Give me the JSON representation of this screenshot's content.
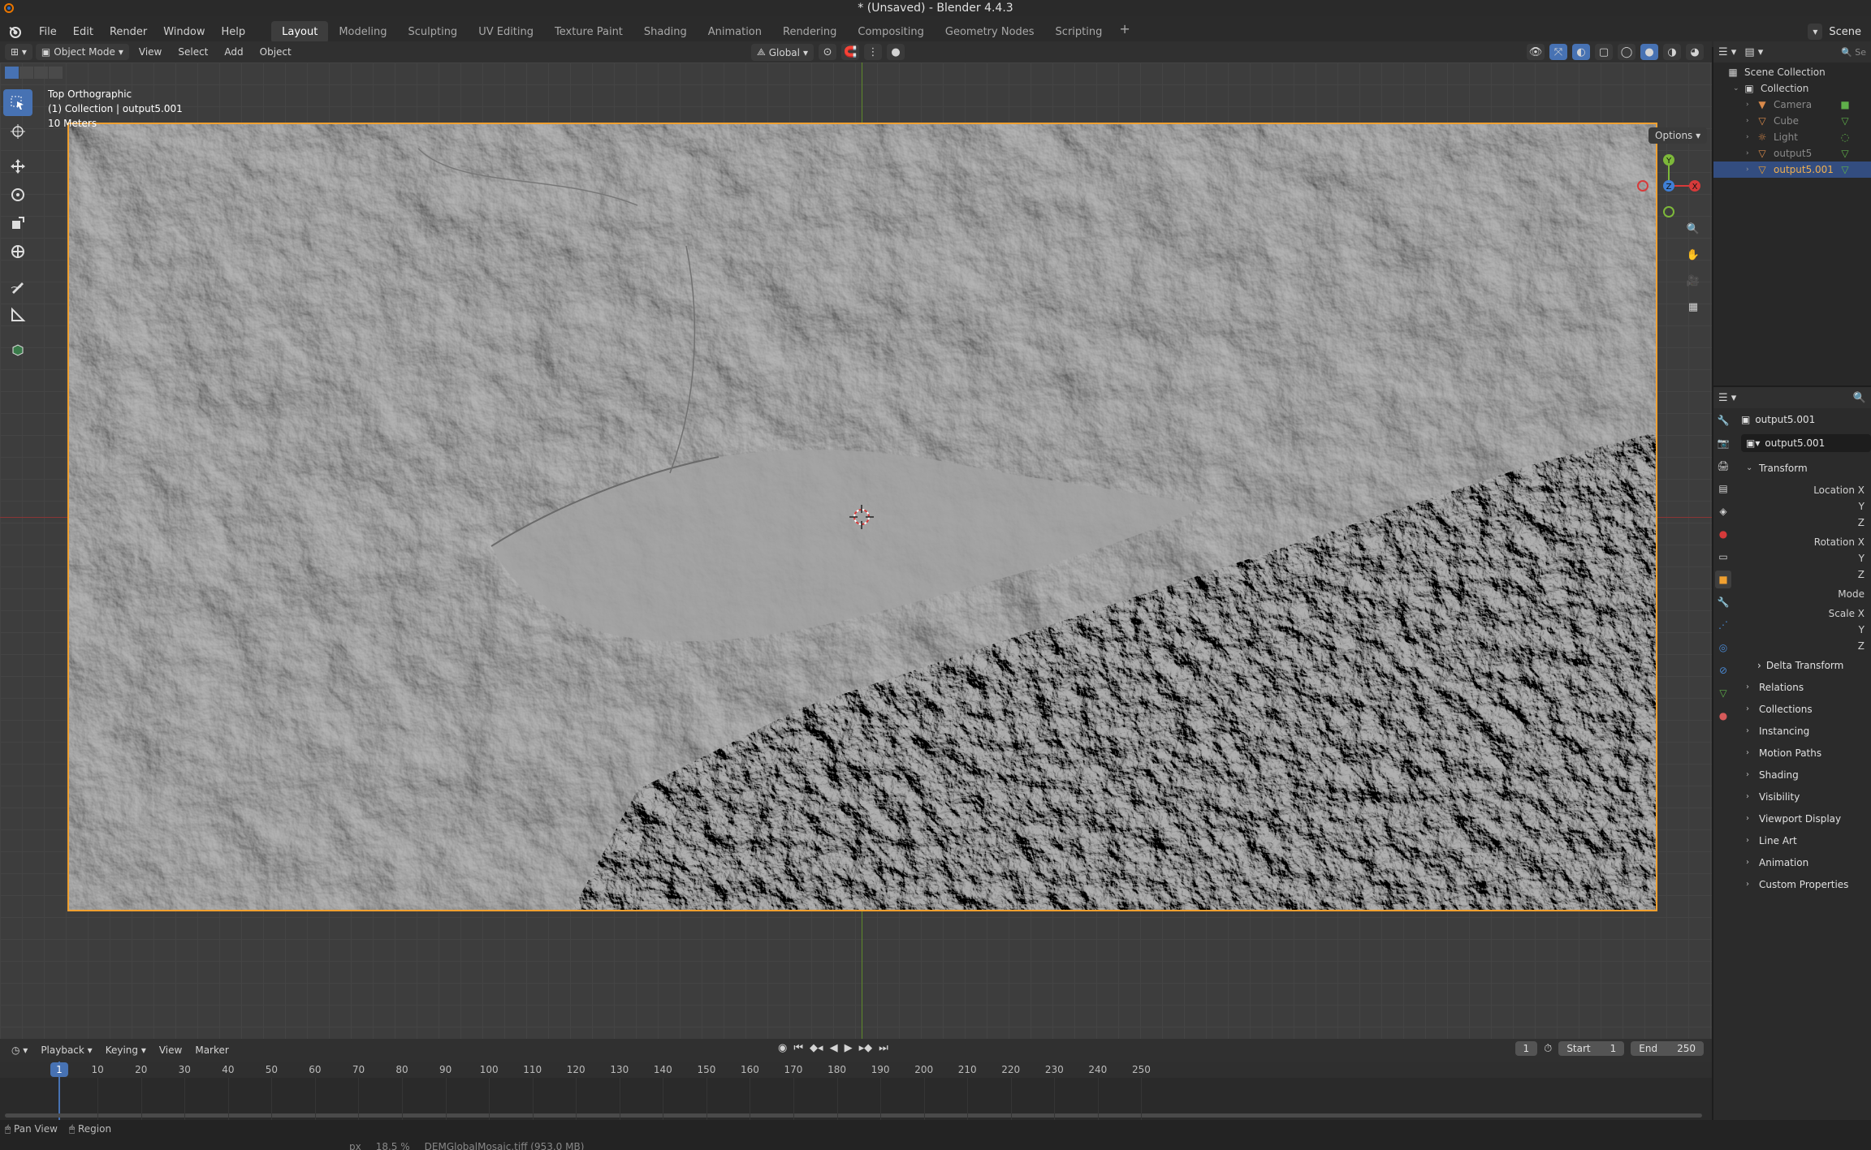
{
  "window": {
    "title": "* (Unsaved) - Blender 4.4.3"
  },
  "menubar": {
    "menus": [
      "File",
      "Edit",
      "Render",
      "Window",
      "Help"
    ],
    "workspaces": [
      "Layout",
      "Modeling",
      "Sculpting",
      "UV Editing",
      "Texture Paint",
      "Shading",
      "Animation",
      "Rendering",
      "Compositing",
      "Geometry Nodes",
      "Scripting"
    ],
    "active_workspace": "Layout",
    "add_tab": "+",
    "scene": "Scene"
  },
  "viewport_header": {
    "mode": "Object Mode",
    "menus": [
      "View",
      "Select",
      "Add",
      "Object"
    ],
    "orientation": "Global",
    "options": "Options"
  },
  "viewport": {
    "view_name": "Top Orthographic",
    "collection_info": "(1) Collection | output5.001",
    "scale": "10 Meters",
    "gizmo": {
      "x_label": "X",
      "y_label": "Y",
      "z_label": "Z"
    }
  },
  "timeline": {
    "menus": [
      "Playback",
      "Keying",
      "View",
      "Marker"
    ],
    "current_frame": "1",
    "start_label": "Start",
    "start": "1",
    "end_label": "End",
    "end": "250",
    "ruler": [
      "10",
      "20",
      "30",
      "40",
      "50",
      "60",
      "70",
      "80",
      "90",
      "100",
      "110",
      "120",
      "130",
      "140",
      "150",
      "160",
      "170",
      "180",
      "190",
      "200",
      "210",
      "220",
      "230",
      "240",
      "250"
    ],
    "playhead_label": "1"
  },
  "statusbar": {
    "left": [
      "Pan View",
      "Region"
    ],
    "bottom": [
      "px",
      "18.5 %",
      "DEMGlobalMosaic.tiff (953.0 MB)"
    ]
  },
  "outliner": {
    "search_placeholder": "Se",
    "items": [
      {
        "label": "Scene Collection",
        "icon": "scene-collection-icon"
      },
      {
        "label": "Collection",
        "icon": "collection-icon"
      },
      {
        "label": "Camera",
        "icon": "camera-icon"
      },
      {
        "label": "Cube",
        "icon": "mesh-icon"
      },
      {
        "label": "Light",
        "icon": "light-icon"
      },
      {
        "label": "output5",
        "icon": "mesh-icon"
      },
      {
        "label": "output5.001",
        "icon": "mesh-icon"
      }
    ]
  },
  "properties": {
    "object_name": "output5.001",
    "object_field": "output5.001",
    "transform": {
      "title": "Transform",
      "location_x": "Location X",
      "location_y": "Y",
      "location_z": "Z",
      "rotation_x": "Rotation X",
      "rotation_y": "Y",
      "rotation_z": "Z",
      "mode": "Mode",
      "scale_x": "Scale X",
      "scale_y": "Y",
      "scale_z": "Z",
      "delta": "Delta Transform"
    },
    "panels": [
      "Relations",
      "Collections",
      "Instancing",
      "Motion Paths",
      "Shading",
      "Visibility",
      "Viewport Display",
      "Line Art",
      "Animation",
      "Custom Properties"
    ]
  },
  "colors": {
    "accent": "#4772b3",
    "selection_outline": "#f0a030",
    "x_axis": "#d63a3a",
    "y_axis": "#7db83a",
    "z_axis": "#3f7fd6"
  }
}
